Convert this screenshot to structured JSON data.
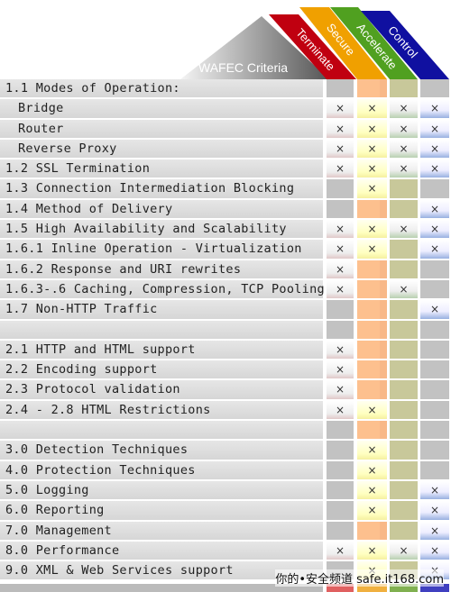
{
  "header": {
    "title": "WAFEC Criteria",
    "categories": [
      {
        "label": "Terminate",
        "color": "#c00010"
      },
      {
        "label": "Secure",
        "color": "#f0a000"
      },
      {
        "label": "Accelerate",
        "color": "#50a020"
      },
      {
        "label": "Control",
        "color": "#1010a0"
      }
    ]
  },
  "mark": "×",
  "rows": [
    {
      "label": "1.1 Modes of Operation:",
      "sub": false,
      "marks": [
        0,
        0,
        0,
        0
      ]
    },
    {
      "label": "Bridge",
      "sub": true,
      "marks": [
        1,
        1,
        1,
        1
      ]
    },
    {
      "label": "Router",
      "sub": true,
      "marks": [
        1,
        1,
        1,
        1
      ]
    },
    {
      "label": "Reverse Proxy",
      "sub": true,
      "marks": [
        1,
        1,
        1,
        1
      ]
    },
    {
      "label": "1.2 SSL Termination",
      "sub": false,
      "marks": [
        1,
        1,
        1,
        1
      ]
    },
    {
      "label": "1.3 Connection Intermediation Blocking",
      "sub": false,
      "marks": [
        0,
        1,
        0,
        0
      ]
    },
    {
      "label": "1.4 Method of Delivery",
      "sub": false,
      "marks": [
        0,
        0,
        0,
        1
      ]
    },
    {
      "label": "1.5 High Availability and Scalability",
      "sub": false,
      "marks": [
        1,
        1,
        1,
        1
      ]
    },
    {
      "label": "1.6.1 Inline Operation - Virtualization",
      "sub": false,
      "marks": [
        1,
        1,
        0,
        1
      ]
    },
    {
      "label": "1.6.2 Response and URI rewrites",
      "sub": false,
      "marks": [
        1,
        0,
        0,
        0
      ]
    },
    {
      "label": "1.6.3-.6 Caching, Compression, TCP Pooling",
      "sub": false,
      "marks": [
        1,
        0,
        1,
        0
      ]
    },
    {
      "label": "1.7 Non-HTTP Traffic",
      "sub": false,
      "marks": [
        0,
        0,
        0,
        1
      ]
    },
    {
      "label": "",
      "sub": false,
      "marks": [
        0,
        0,
        0,
        0
      ]
    },
    {
      "label": "2.1 HTTP and HTML support",
      "sub": false,
      "marks": [
        1,
        0,
        0,
        0
      ]
    },
    {
      "label": "2.2 Encoding support",
      "sub": false,
      "marks": [
        1,
        0,
        0,
        0
      ]
    },
    {
      "label": "2.3 Protocol validation",
      "sub": false,
      "marks": [
        1,
        0,
        0,
        0
      ]
    },
    {
      "label": "2.4 - 2.8 HTML Restrictions",
      "sub": false,
      "marks": [
        1,
        1,
        0,
        0
      ]
    },
    {
      "label": "",
      "sub": false,
      "marks": [
        0,
        0,
        0,
        0
      ]
    },
    {
      "label": "3.0 Detection Techniques",
      "sub": false,
      "marks": [
        0,
        1,
        0,
        0
      ]
    },
    {
      "label": "4.0 Protection Techniques",
      "sub": false,
      "marks": [
        0,
        1,
        0,
        0
      ]
    },
    {
      "label": "5.0 Logging",
      "sub": false,
      "marks": [
        0,
        1,
        0,
        1
      ]
    },
    {
      "label": "6.0 Reporting",
      "sub": false,
      "marks": [
        0,
        1,
        0,
        1
      ]
    },
    {
      "label": "7.0 Management",
      "sub": false,
      "marks": [
        0,
        0,
        0,
        1
      ]
    },
    {
      "label": "8.0 Performance",
      "sub": false,
      "marks": [
        1,
        1,
        1,
        1
      ]
    },
    {
      "label": "9.0 XML & Web Services support",
      "sub": false,
      "marks": [
        0,
        1,
        0,
        1
      ]
    }
  ],
  "watermark": "你的•安全频道 safe.it168.com"
}
